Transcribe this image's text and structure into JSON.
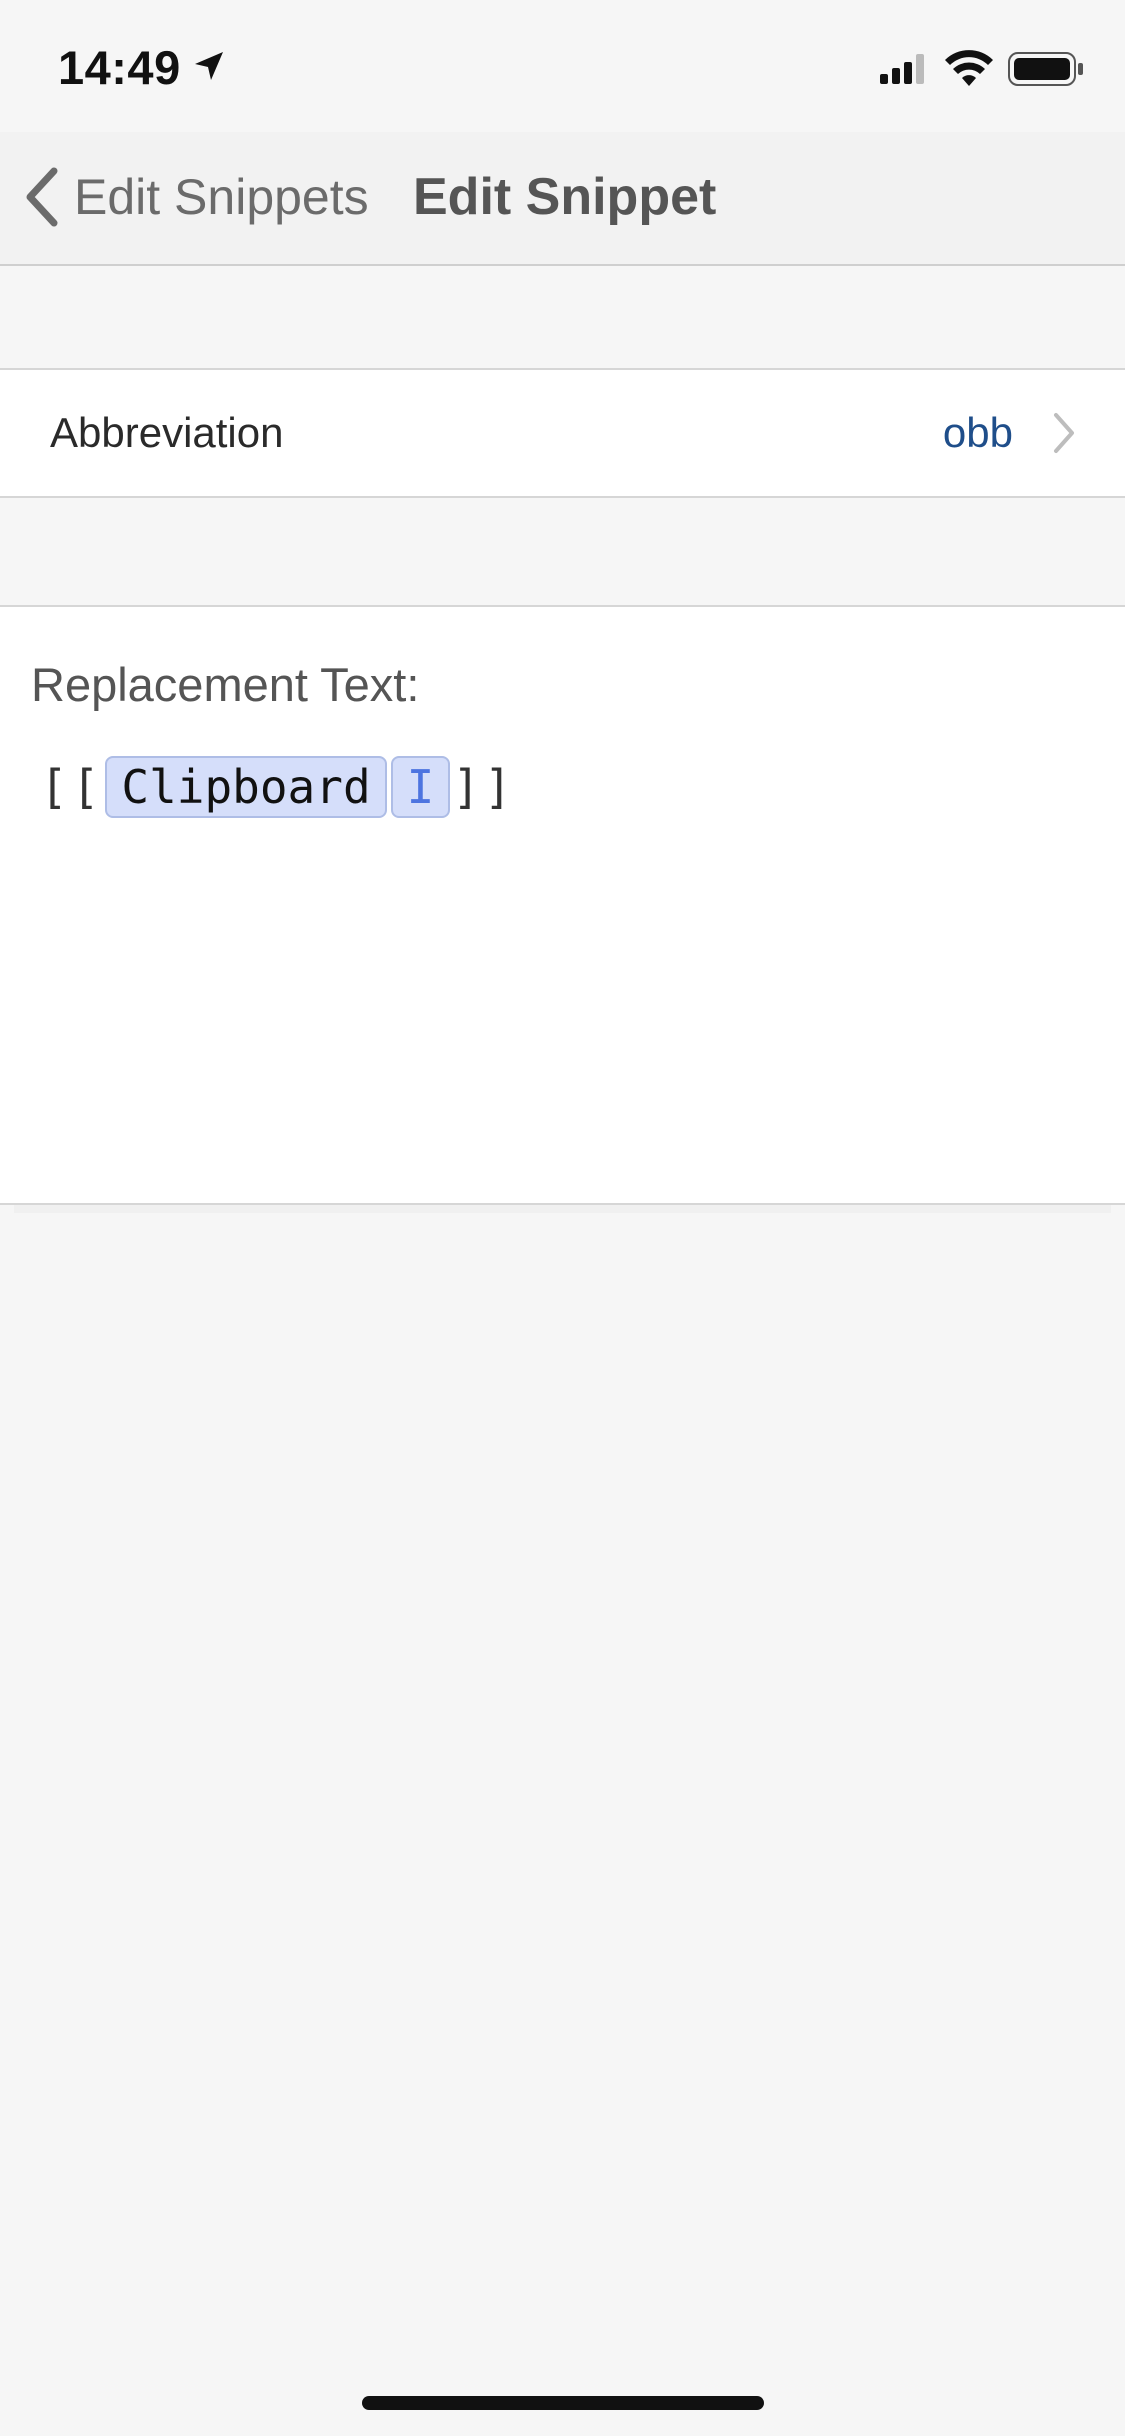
{
  "status_bar": {
    "time": "14:49",
    "icons": [
      "location-arrow-icon",
      "cellular-signal-icon",
      "wifi-icon",
      "battery-icon"
    ]
  },
  "nav": {
    "back_label": "Edit Snippets",
    "title": "Edit Snippet"
  },
  "abbreviation": {
    "label": "Abbreviation",
    "value": "obb"
  },
  "replacement": {
    "label": "Replacement Text:",
    "open_brackets": "[[",
    "token_name": "Clipboard",
    "token_flag": "I",
    "close_brackets": "]]"
  },
  "colors": {
    "accent_value": "#1f4e8a",
    "token_background": "#d5defa",
    "token_flag": "#4d74e0",
    "background": "#f6f6f6"
  }
}
